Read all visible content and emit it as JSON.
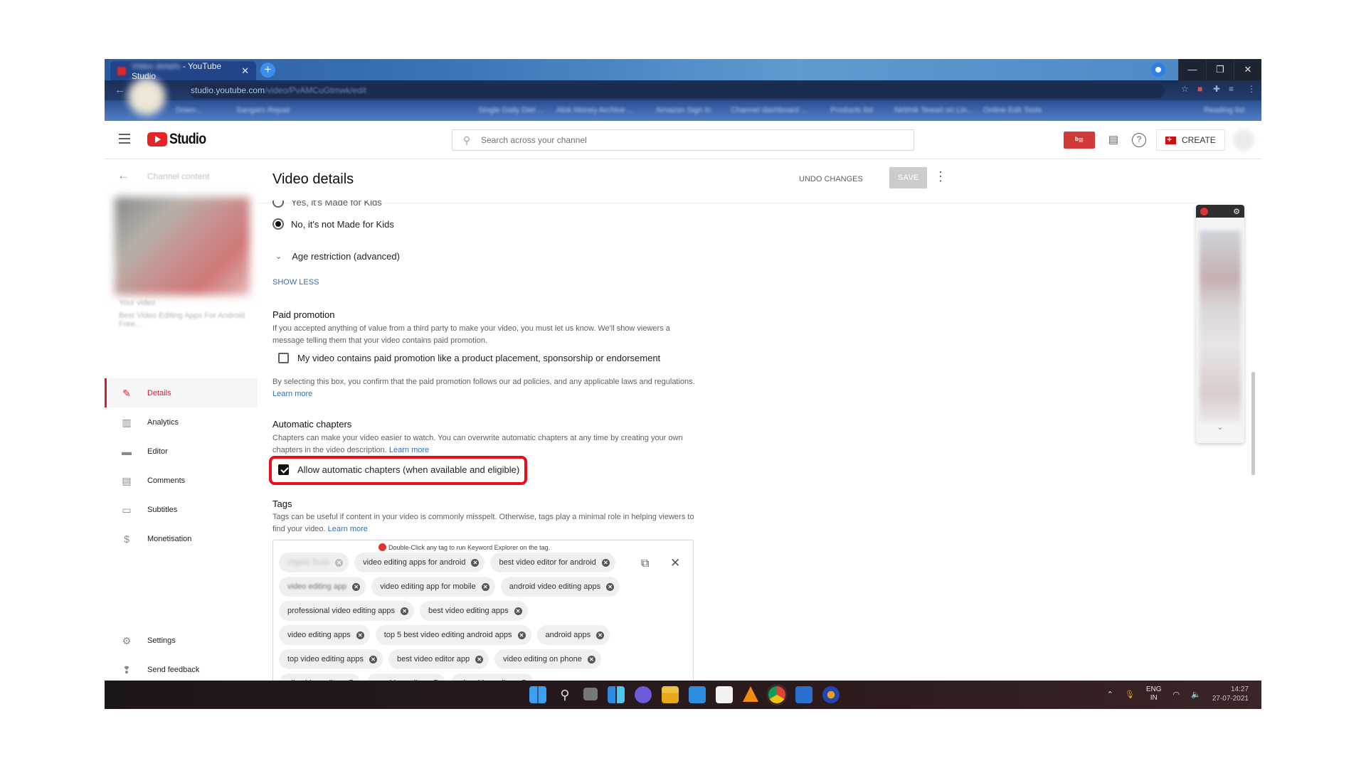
{
  "browser": {
    "tab_title_blurred": "Video details",
    "tab_title": " - YouTube Studio",
    "url_domain": "studio.youtube.com",
    "url_path": "/video/PvAMCuGtmwk/edit",
    "bookmarks": [
      "Down...",
      "Sangam Repair",
      "Single Daily Diet ...",
      "Alok Money Archive ...",
      "Amazon Sign In",
      "Channel dashboard ...",
      "Products list",
      "Nirbhik Tewari on Lin...",
      "Online Edit Tools",
      "Reading list"
    ],
    "window_controls": {
      "minimize": "—",
      "restore": "❐",
      "close": "✕"
    }
  },
  "header": {
    "app_name": "Studio",
    "search_placeholder": "Search across your channel",
    "vidiq_label": "ᵇ≡",
    "create_label": "CREATE"
  },
  "sidebar": {
    "back_label": "Channel content",
    "your_video_label": "Your video",
    "video_title": "Best Video Editing Apps For Android Free...",
    "items": [
      {
        "label": "Details",
        "icon": "pencil-icon",
        "active": true
      },
      {
        "label": "Analytics",
        "icon": "analytics-icon"
      },
      {
        "label": "Editor",
        "icon": "clapperboard-icon"
      },
      {
        "label": "Comments",
        "icon": "comments-icon"
      },
      {
        "label": "Subtitles",
        "icon": "subtitles-icon"
      },
      {
        "label": "Monetisation",
        "icon": "dollar-icon"
      }
    ],
    "bottom_items": [
      {
        "label": "Settings",
        "icon": "gear-icon"
      },
      {
        "label": "Send feedback",
        "icon": "feedback-icon"
      }
    ]
  },
  "main": {
    "title": "Video details",
    "undo_label": "UNDO CHANGES",
    "save_label": "SAVE",
    "audience": {
      "yes_label": "Yes, it's Made for Kids",
      "no_label": "No, it's not Made for Kids",
      "selected": "no"
    },
    "age_restriction_label": "Age restriction (advanced)",
    "show_less_label": "SHOW LESS",
    "paid_promotion": {
      "heading": "Paid promotion",
      "description": "If you accepted anything of value from a third party to make your video, you must let us know. We'll show viewers a message telling them that your video contains paid promotion.",
      "checkbox_label": "My video contains paid promotion like a product placement, sponsorship or endorsement",
      "checked": false,
      "note": "By selecting this box, you confirm that the paid promotion follows our ad policies, and any applicable laws and regulations.",
      "learn_more": "Learn more"
    },
    "automatic_chapters": {
      "heading": "Automatic chapters",
      "description": "Chapters can make your video easier to watch. You can overwrite automatic chapters at any time by creating your own chapters in the video description.",
      "learn_more": "Learn more",
      "checkbox_label": "Allow automatic chapters (when available and eligible)",
      "checked": true
    },
    "tags": {
      "heading": "Tags",
      "description": "Tags can be useful if content in your video is commonly misspelt. Otherwise, tags play a minimal role in helping viewers to find your video.",
      "learn_more": "Learn more",
      "keyword_note": "Double-Click any tag to run Keyword Explorer on the tag.",
      "rows": [
        [
          "Digital Tools",
          "video editing apps for android",
          "best video editor for android"
        ],
        [
          "video editing app",
          "video editing app for mobile",
          "android video editing apps"
        ],
        [
          "professional video editing apps",
          "best video editing apps"
        ],
        [
          "video editing apps",
          "top 5 best video editing android apps",
          "android apps"
        ],
        [
          "top video editing apps",
          "best video editor app",
          "video editing on phone"
        ],
        [
          "vllo video editor",
          "vn video editor",
          "vita video editor"
        ]
      ]
    }
  },
  "taskbar": {
    "apps": [
      "start",
      "search",
      "task-view",
      "widgets",
      "teams-chat",
      "file-explorer",
      "mail",
      "store",
      "vlc",
      "chrome",
      "photos",
      "app"
    ],
    "lang_top": "ENG",
    "lang_bottom": "IN",
    "time": "14:27",
    "date": "27-07-2021"
  }
}
